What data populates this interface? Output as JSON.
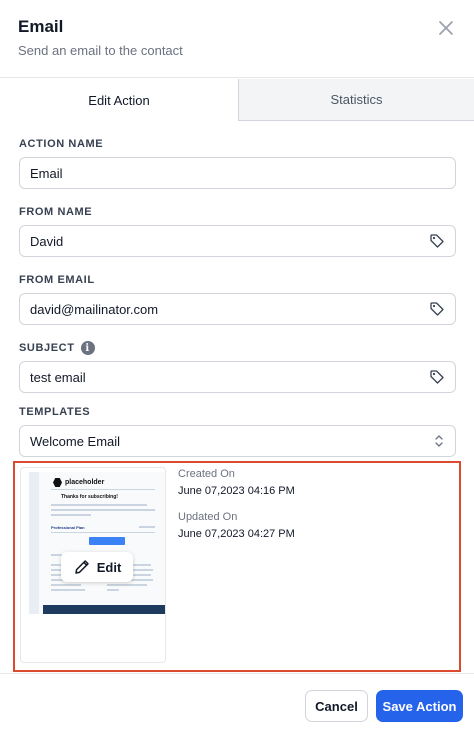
{
  "header": {
    "title": "Email",
    "subtitle": "Send an email to the contact",
    "close_icon": "close-icon"
  },
  "tabs": [
    {
      "label": "Edit Action",
      "active": true
    },
    {
      "label": "Statistics",
      "active": false
    }
  ],
  "fields": {
    "action_name": {
      "label": "ACTION NAME",
      "value": "Email"
    },
    "from_name": {
      "label": "FROM NAME",
      "value": "David",
      "icon": "tag-icon"
    },
    "from_email": {
      "label": "FROM EMAIL",
      "value": "david@mailinator.com",
      "icon": "tag-icon"
    },
    "subject": {
      "label": "SUBJECT",
      "value": "test email",
      "icon": "tag-icon",
      "info_icon": "info-icon"
    },
    "templates": {
      "label": "TEMPLATES",
      "value": "Welcome Email",
      "icon": "chevron-updown-icon"
    }
  },
  "template_preview": {
    "logo_text": "placeholder",
    "headline": "Thanks for subscribing!",
    "plan": "Professional Plan",
    "edit_label": "Edit",
    "created_label": "Created On",
    "created_value": "June 07,2023 04:16 PM",
    "updated_label": "Updated On",
    "updated_value": "June 07,2023 04:27 PM"
  },
  "footer": {
    "cancel_label": "Cancel",
    "save_label": "Save Action"
  },
  "colors": {
    "primary": "#2563eb",
    "highlight_border": "#dc4a32"
  }
}
